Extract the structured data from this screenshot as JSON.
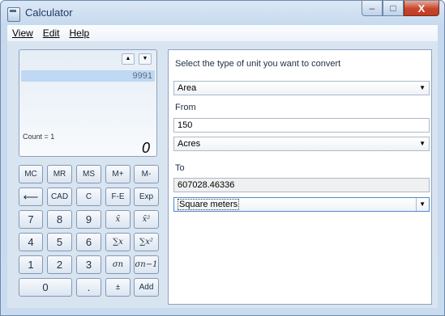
{
  "window": {
    "title": "Calculator",
    "controls": {
      "minimize": "‒",
      "maximize": "□",
      "close": "X"
    }
  },
  "menu": [
    {
      "label": "View"
    },
    {
      "label": "Edit"
    },
    {
      "label": "Help"
    }
  ],
  "calculator": {
    "history_up": "▲",
    "history_down": "▼",
    "history_value": "9991",
    "count_label": "Count = 1",
    "display_value": "0",
    "buttons": {
      "mc": "MC",
      "mr": "MR",
      "ms": "MS",
      "mplus": "M+",
      "mminus": "M-",
      "backspace": "⟵",
      "cad": "CAD",
      "c": "C",
      "fe": "F-E",
      "exp": "Exp",
      "n7": "7",
      "n8": "8",
      "n9": "9",
      "mean": "x̄",
      "mean_sq": "x̄²",
      "n4": "4",
      "n5": "5",
      "n6": "6",
      "sum": "∑x",
      "sum_sq": "∑x²",
      "n1": "1",
      "n2": "2",
      "n3": "3",
      "sigma_n": "σn",
      "sigma_n1": "σn−1",
      "n0": "0",
      "dot": ".",
      "plusminus": "±",
      "add": "Add"
    }
  },
  "converter": {
    "heading": "Select the type of unit you want to convert",
    "type_value": "Area",
    "from_label": "From",
    "from_value": "150",
    "from_unit": "Acres",
    "to_label": "To",
    "to_value": "607028.46336",
    "to_unit": "Square meters",
    "dropdown_glyph": "▼"
  }
}
